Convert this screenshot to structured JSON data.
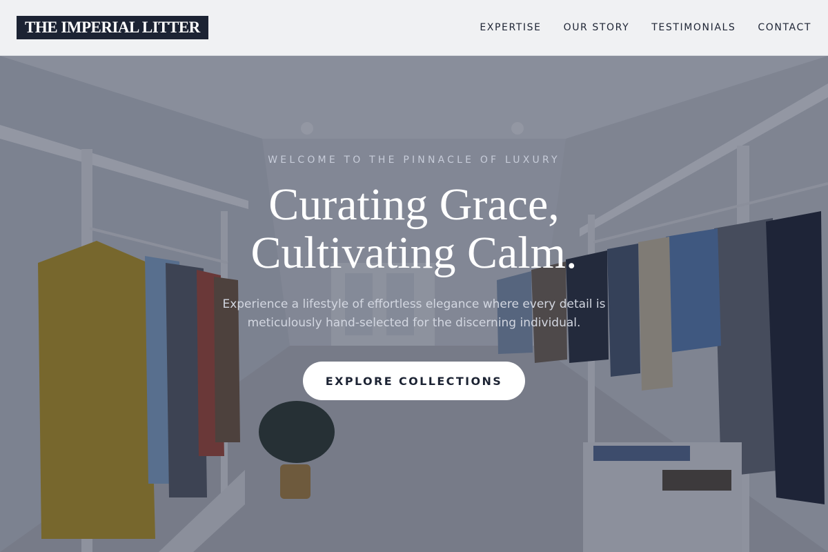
{
  "header": {
    "logo": "THE IMPERIAL LITTER",
    "nav": [
      {
        "label": "EXPERTISE"
      },
      {
        "label": "OUR STORY"
      },
      {
        "label": "TESTIMONIALS"
      },
      {
        "label": "CONTACT"
      }
    ]
  },
  "hero": {
    "eyebrow": "WELCOME TO THE PINNACLE OF LUXURY",
    "headline_line1": "Curating Grace,",
    "headline_line2": "Cultivating Calm.",
    "subtitle_line1": "Experience a lifestyle of effortless elegance where every detail is",
    "subtitle_line2": "meticulously hand-selected for the discerning individual.",
    "cta_label": "EXPLORE COLLECTIONS"
  },
  "colors": {
    "brand_navy": "#1c2333",
    "header_bg": "#f0f1f3",
    "overlay": "#1e263e",
    "cta_bg": "#ffffff"
  }
}
